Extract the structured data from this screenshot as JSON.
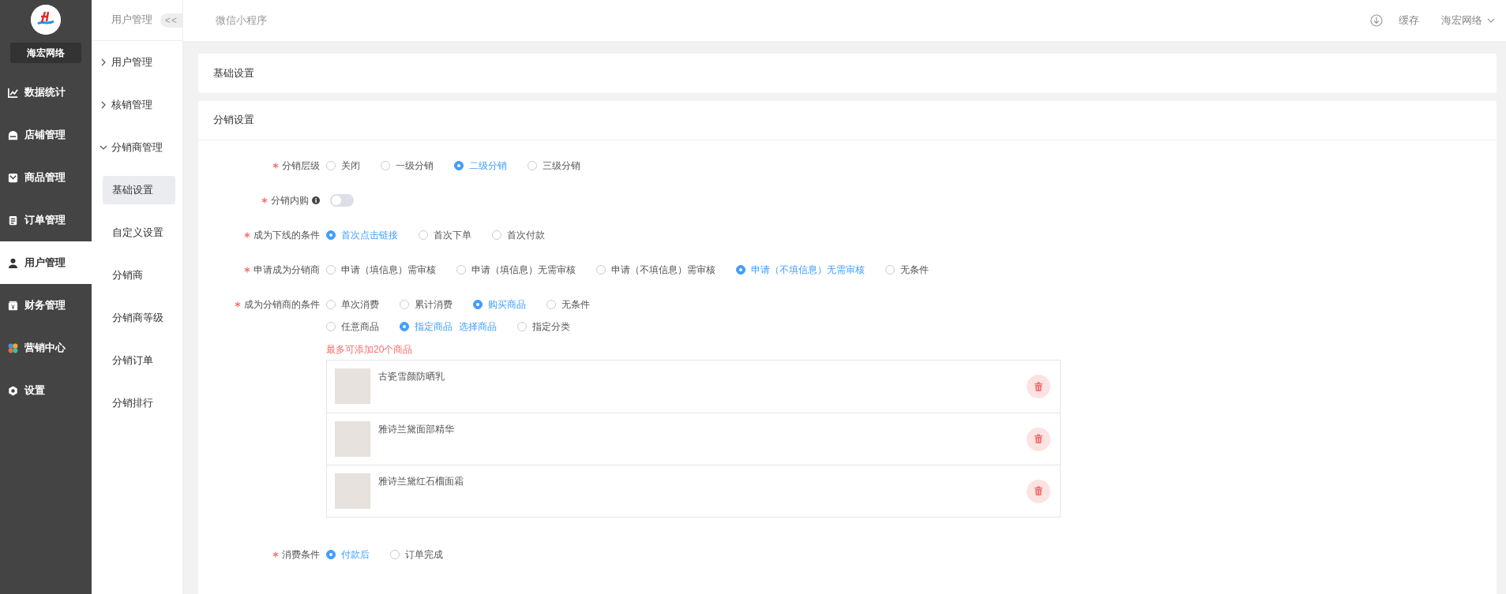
{
  "sidebar": {
    "brand": "海宏网络",
    "items": [
      {
        "label": "数据统计",
        "kind": "chart",
        "selected": false
      },
      {
        "label": "店铺管理",
        "kind": "shop",
        "selected": false
      },
      {
        "label": "商品管理",
        "kind": "goods",
        "selected": false
      },
      {
        "label": "订单管理",
        "kind": "order",
        "selected": false
      },
      {
        "label": "用户管理",
        "kind": "user",
        "selected": true
      },
      {
        "label": "财务管理",
        "kind": "finance",
        "selected": false
      },
      {
        "label": "营销中心",
        "kind": "marketing",
        "selected": false
      },
      {
        "label": "设置",
        "kind": "settings",
        "selected": false
      }
    ]
  },
  "subnav": {
    "title": "用户管理",
    "collapse_button": "<<",
    "groups": [
      {
        "label": "用户管理",
        "expanded": false
      },
      {
        "label": "核销管理",
        "expanded": false
      },
      {
        "label": "分销商管理",
        "expanded": true,
        "children": [
          {
            "label": "基础设置",
            "selected": true
          },
          {
            "label": "自定义设置",
            "selected": false
          },
          {
            "label": "分销商",
            "selected": false
          },
          {
            "label": "分销商等级",
            "selected": false
          },
          {
            "label": "分销订单",
            "selected": false
          },
          {
            "label": "分销排行",
            "selected": false
          }
        ]
      }
    ]
  },
  "topbar": {
    "tab": "微信小程序",
    "cache_button": "缓存",
    "account": "海宏网络"
  },
  "panels": [
    {
      "title": "基础设置"
    },
    {
      "title": "分销设置",
      "rows": [
        {
          "kind": "radio",
          "label": "分销层级",
          "required": true,
          "options": [
            {
              "label": "关闭",
              "selected": false
            },
            {
              "label": "一级分销",
              "selected": false
            },
            {
              "label": "二级分销",
              "selected": true
            },
            {
              "label": "三级分销",
              "selected": false
            }
          ]
        },
        {
          "kind": "switch",
          "label": "分销内购",
          "required": true,
          "info": true,
          "on": false
        },
        {
          "kind": "radio",
          "label": "成为下线的条件",
          "required": true,
          "options": [
            {
              "label": "首次点击链接",
              "selected": true
            },
            {
              "label": "首次下单",
              "selected": false
            },
            {
              "label": "首次付款",
              "selected": false
            }
          ]
        },
        {
          "kind": "radio",
          "label": "申请成为分销商",
          "required": true,
          "options": [
            {
              "label": "申请（填信息）需审核",
              "selected": false
            },
            {
              "label": "申请（填信息）无需审核",
              "selected": false
            },
            {
              "label": "申请（不填信息）需审核",
              "selected": false
            },
            {
              "label": "申请（不填信息）无需审核",
              "selected": true
            },
            {
              "label": "无条件",
              "selected": false
            }
          ]
        },
        {
          "kind": "goods",
          "label": "成为分销商的条件",
          "required": true,
          "options": [
            {
              "label": "单次消费",
              "selected": false
            },
            {
              "label": "累计消费",
              "selected": false
            },
            {
              "label": "购买商品",
              "selected": true
            },
            {
              "label": "无条件",
              "selected": false
            }
          ],
          "scope_options": [
            {
              "label": "任意商品",
              "selected": false
            },
            {
              "label": "指定商品",
              "selected": true,
              "link": "选择商品"
            },
            {
              "label": "指定分类",
              "selected": false
            }
          ],
          "note": "最多可添加20个商品",
          "products": [
            {
              "name": "古瓷雪颜防晒乳"
            },
            {
              "name": "雅诗兰黛面部精华"
            },
            {
              "name": "雅诗兰黛红石榴面霜"
            }
          ]
        },
        {
          "kind": "radio",
          "label": "消费条件",
          "required": true,
          "options": [
            {
              "label": "付款后",
              "selected": true
            },
            {
              "label": "订单完成",
              "selected": false
            }
          ]
        }
      ]
    }
  ]
}
